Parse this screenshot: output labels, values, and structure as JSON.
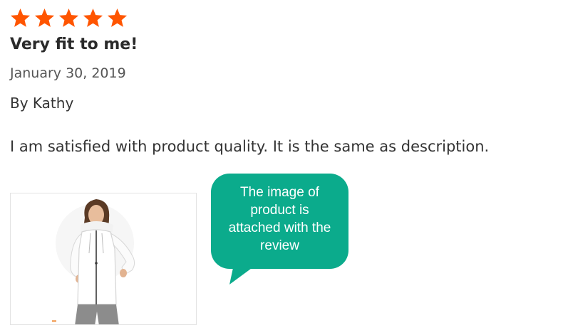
{
  "review": {
    "rating": 5,
    "max_rating": 5,
    "star_color": "#ff5500",
    "title": "Very fit to me!",
    "date": "January 30, 2019",
    "author": "By Kathy",
    "body": "I am satisfied with product quality. It is the same as description."
  },
  "attachment": {
    "icon": "product-photo-woman-white-hoodie"
  },
  "callout": {
    "text": "The image of product is attached with the review",
    "color": "#0bab8c"
  }
}
